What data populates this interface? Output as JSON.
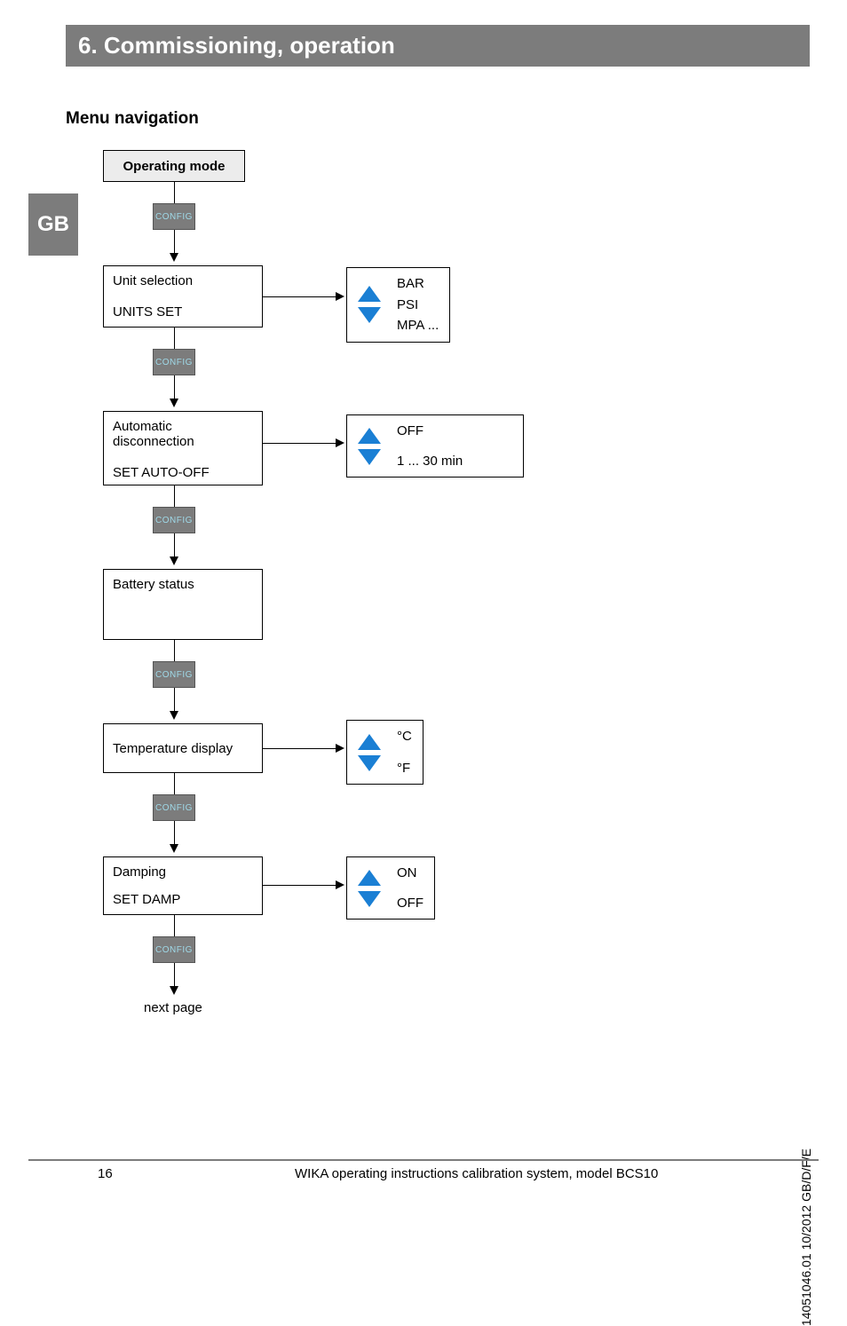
{
  "section_title": "6. Commissioning, operation",
  "lang_tab": "GB",
  "subtitle": "Menu navigation",
  "start_box": "Operating mode",
  "config_label": "CONFIG",
  "nodes": {
    "unit": {
      "title": "Unit selection",
      "subtitle": "UNITS SET",
      "options": [
        "BAR",
        "PSI",
        "MPA ..."
      ]
    },
    "auto": {
      "title": "Automatic disconnection",
      "subtitle": "SET AUTO-OFF",
      "options": [
        "OFF",
        "1 ...  30 min"
      ]
    },
    "battery": {
      "title": "Battery status"
    },
    "temp": {
      "title": "Temperature display",
      "options": [
        "°C",
        "°F"
      ]
    },
    "damp": {
      "title": "Damping",
      "subtitle": "SET DAMP",
      "options": [
        "ON",
        "OFF"
      ]
    }
  },
  "next_page": "next page",
  "footer": {
    "page": "16",
    "text": "WIKA operating instructions calibration system, model BCS10"
  },
  "side_code": "14051046.01 10/2012 GB/D/F/E"
}
